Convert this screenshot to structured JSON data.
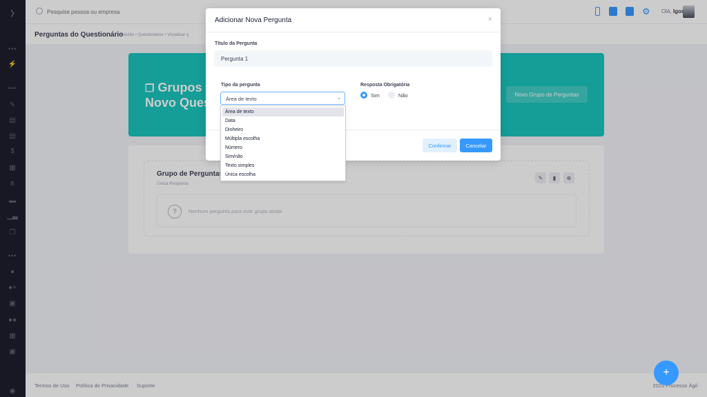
{
  "header": {
    "search_placeholder": "Pesquise pessoa ou empresa",
    "greeting_prefix": "Olá,",
    "user_name": "Igor"
  },
  "subheader": {
    "title": "Perguntas do Questionário",
    "breadcrumbs": "Gestão  •  Questionários  •  Visualizar q"
  },
  "banner": {
    "title_line1": "Grupos",
    "title_line2": "Novo Ques",
    "button": "Novo Grupo de Perguntas",
    "color": "#1bc5bd"
  },
  "group": {
    "title": "Grupo de Perguntas",
    "subtitle": "Única Resposta",
    "empty_message": "Nenhum pergunta para este grupo ainda"
  },
  "footer": {
    "links": [
      "Termos de Uso",
      "Política de Privacidade",
      "Suporte"
    ],
    "copyright": "2023 Processo Ágil"
  },
  "fab": {
    "label": "+"
  },
  "modal": {
    "title": "Adicionar Nova Pergunta",
    "close": "×",
    "title_label": "Título da Pergunta",
    "title_value": "Pergunta 1",
    "type_label": "Tipo da pergunta",
    "type_selected": "Área de texto",
    "required_label": "Resposta Obrigatória",
    "required_yes": "Sim",
    "required_no": "Não",
    "required_value": "Sim",
    "confirm": "Confirmar",
    "cancel": "Cancelar"
  },
  "dropdown_options": [
    "Área de texto",
    "Data",
    "Dinheiro",
    "Múltipla escolha",
    "Número",
    "Sim/não",
    "Texto simples",
    "Única escolha"
  ],
  "colors": {
    "primary": "#3699ff",
    "sidebar": "#1e1e2d"
  }
}
